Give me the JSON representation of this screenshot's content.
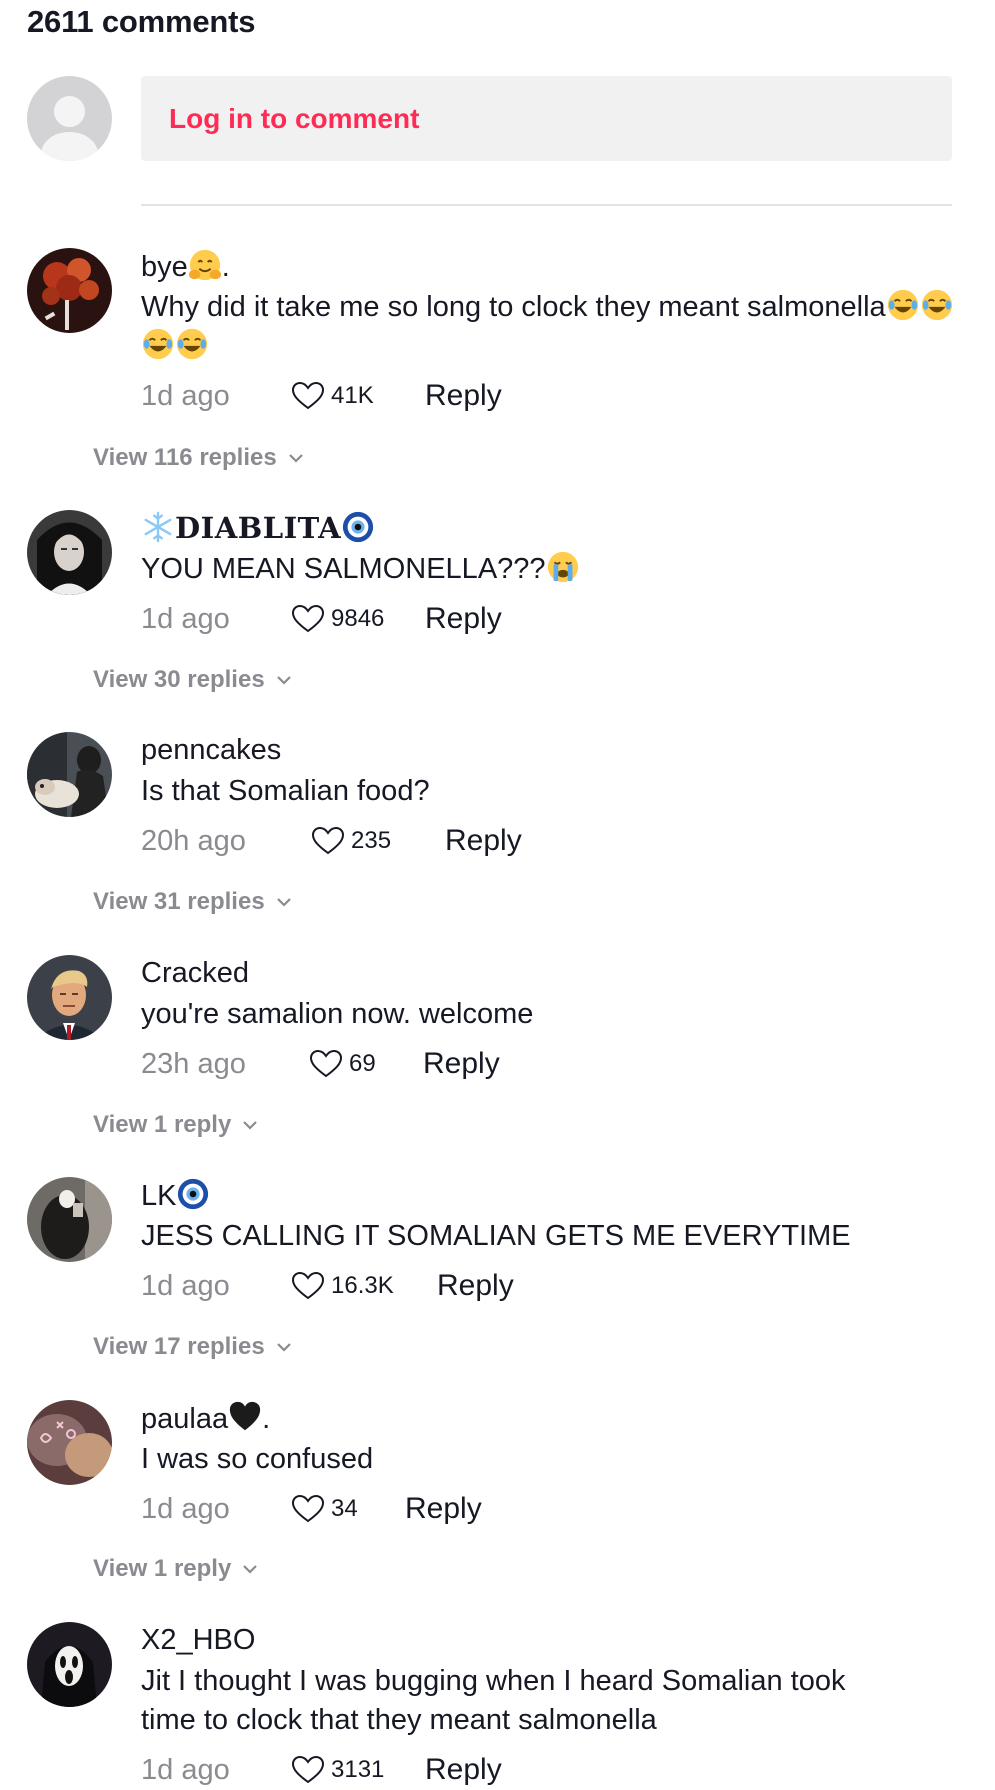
{
  "header": {
    "comment_count_label": "2611 comments"
  },
  "login": {
    "prompt": "Log in to comment"
  },
  "colors": {
    "accent": "#fe2c55",
    "text": "#161823",
    "muted": "#8a8b91",
    "input_bg": "#f1f1f2"
  },
  "comments": [
    {
      "username": "bye",
      "username_suffix": ".",
      "username_emoji": "hugging-face-emoji",
      "text": "Why did it take me so long to clock they meant salmonella",
      "text_emoji": "laughing-tears-emoji x4",
      "time": "1d ago",
      "likes": "41K",
      "reply_label": "Reply",
      "view_replies": "View 116 replies"
    },
    {
      "username": "DIABLITA",
      "username_prefix_emoji": "snowflake-emoji",
      "username_emoji": "nazar-amulet-emoji",
      "text": "YOU MEAN SALMONELLA???",
      "text_emoji": "loudly-crying-emoji",
      "time": "1d ago",
      "likes": "9846",
      "reply_label": "Reply",
      "view_replies": "View 30 replies"
    },
    {
      "username": "penncakes",
      "text": "Is that Somalian food?",
      "time": "20h ago",
      "likes": "235",
      "reply_label": "Reply",
      "view_replies": "View 31 replies"
    },
    {
      "username": "Cracked",
      "text": "you're samalion now. welcome",
      "time": "23h ago",
      "likes": "69",
      "reply_label": "Reply",
      "view_replies": "View 1 reply"
    },
    {
      "username": "LK",
      "username_emoji": "nazar-amulet-emoji",
      "text": "JESS CALLING IT SOMALIAN GETS ME EVERYTIME",
      "time": "1d ago",
      "likes": "16.3K",
      "reply_label": "Reply",
      "view_replies": "View 17 replies"
    },
    {
      "username": "paulaa",
      "username_suffix": ".",
      "username_emoji": "black-heart-emoji",
      "text": "I was so confused",
      "time": "1d ago",
      "likes": "34",
      "reply_label": "Reply",
      "view_replies": "View 1 reply"
    },
    {
      "username": "X2_HBO",
      "text": "Jit I thought I was bugging when I heard Somalian took time to clock that they meant salmonella",
      "time": "1d ago",
      "likes": "3131",
      "reply_label": "Reply"
    }
  ]
}
